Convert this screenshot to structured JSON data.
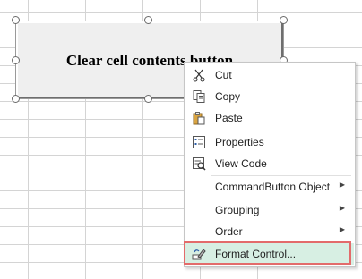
{
  "command_button": {
    "label": "Clear cell contents button"
  },
  "context_menu": {
    "items": [
      {
        "label": "Cut",
        "icon": "scissors-icon"
      },
      {
        "label": "Copy",
        "icon": "copy-icon"
      },
      {
        "label": "Paste",
        "icon": "paste-icon"
      },
      {
        "label": "Properties",
        "icon": "properties-icon"
      },
      {
        "label": "View Code",
        "icon": "view-code-icon"
      },
      {
        "label": "CommandButton Object",
        "submenu": true
      },
      {
        "label": "Grouping",
        "submenu": true
      },
      {
        "label": "Order",
        "submenu": true
      },
      {
        "label": "Format Control...",
        "icon": "format-control-icon",
        "highlighted": true
      }
    ]
  },
  "colors": {
    "highlight_border": "#e36b6b",
    "highlight_fill": "#d7efe3",
    "grid_line": "#d4d4d4"
  }
}
